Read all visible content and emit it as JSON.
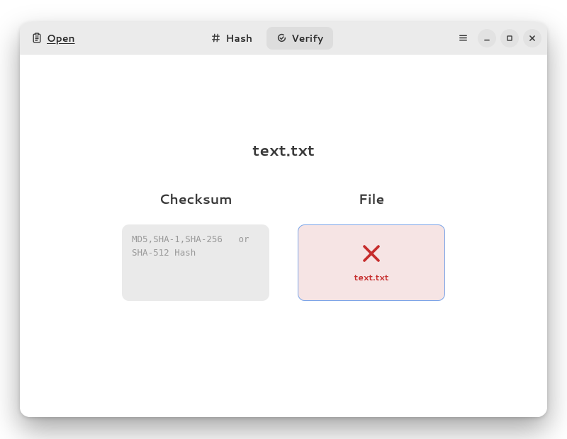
{
  "header": {
    "open_label": "Open",
    "tabs": [
      {
        "label": "Hash",
        "active": false
      },
      {
        "label": "Verify",
        "active": true
      }
    ],
    "icons": {
      "open": "paste-icon",
      "hash": "hash-icon",
      "verify": "verify-icon",
      "menu": "hamburger-icon",
      "min": "minimize-icon",
      "max": "maximize-icon",
      "close": "close-icon"
    }
  },
  "main": {
    "file_title": "text.txt",
    "checksum": {
      "heading": "Checksum",
      "placeholder": "MD5,SHA-1,SHA-256   or SHA-512 Hash"
    },
    "file": {
      "heading": "File",
      "filename": "text.txt",
      "status": "mismatch",
      "status_color": "#c62d2d",
      "border_color": "#7aa4e8",
      "bg_color": "#f6e4e4"
    }
  }
}
